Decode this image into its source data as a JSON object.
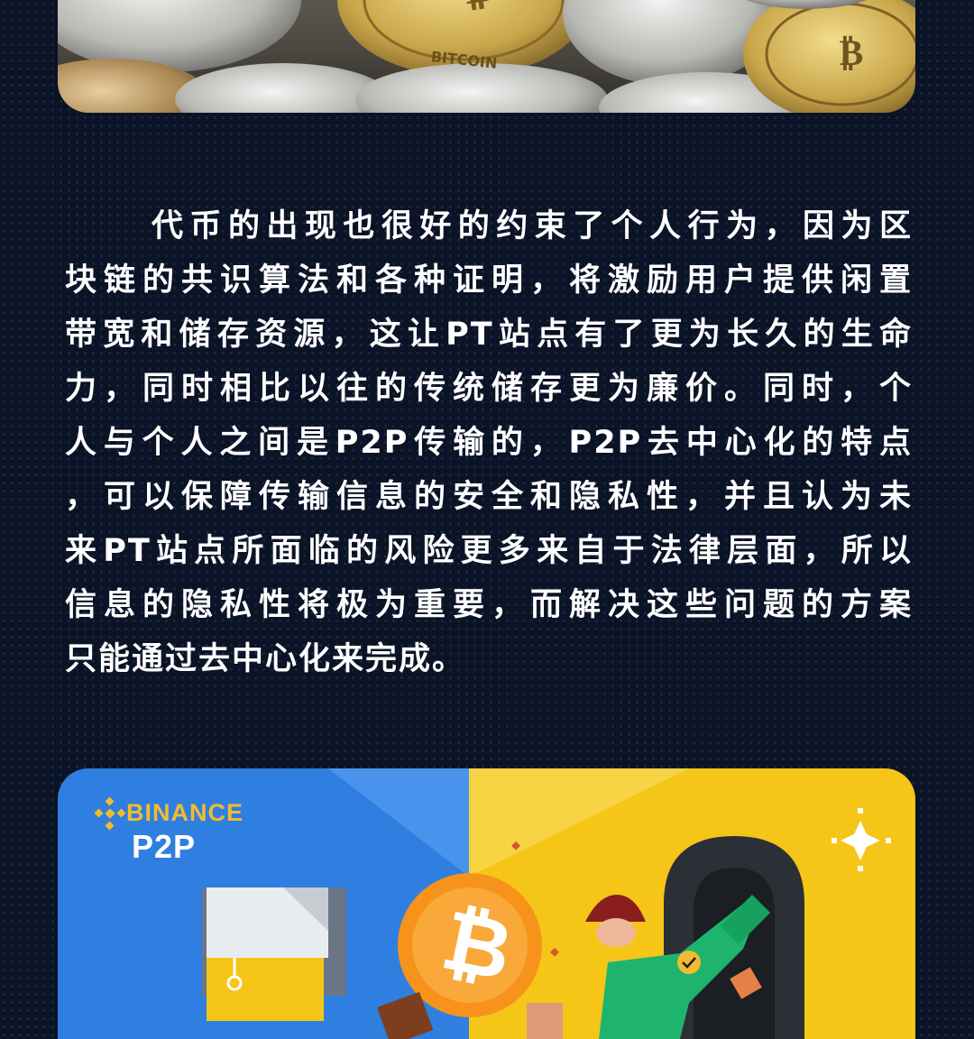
{
  "article": {
    "paragraph_lines": [
      "代币的出现也很好的约束了个人行为，因为区",
      "块链的共识算法和各种证明，将激励用户提供闲置",
      "带宽和储存资源，这让PT站点有了更为长久的生命",
      "力，同时相比以往的传统储存更为廉价。同时，个",
      "人与个人之间是P2P传输的，P2P去中心化的特点",
      "，可以保障传输信息的安全和隐私性，并且认为未",
      "来PT站点所面临的风险更多来自于法律层面，所以",
      "信息的隐私性将极为重要，而解决这些问题的方案",
      "只能通过去中心化来完成。"
    ]
  },
  "binance_card": {
    "brand": "BINANCE",
    "product": "P2P",
    "btc_symbol": "₿"
  },
  "colors": {
    "background": "#0b1326",
    "text": "#ffffff",
    "binance_yellow": "#f3ba2f",
    "card_blue": "#2f7fe0",
    "card_yellow": "#f5c518",
    "btc_orange": "#f7931a"
  }
}
